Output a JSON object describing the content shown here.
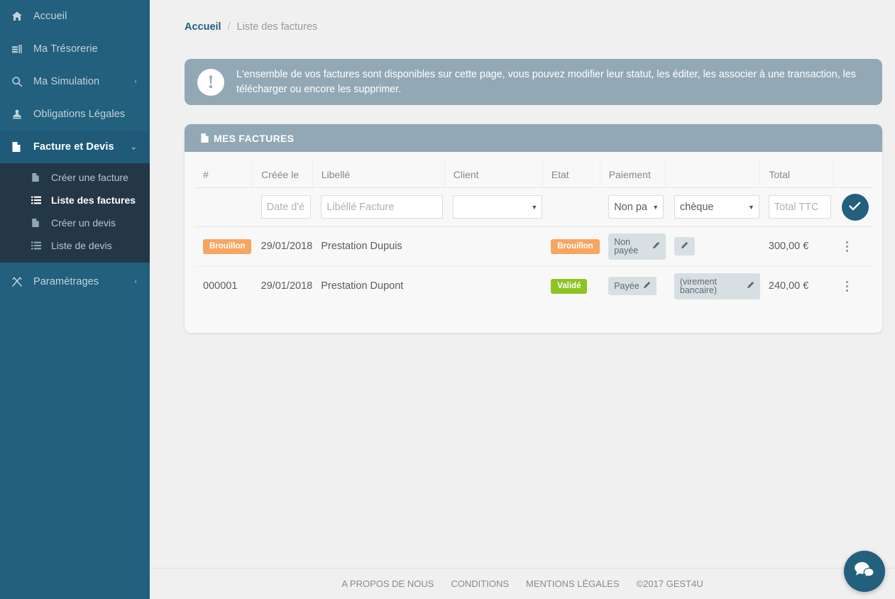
{
  "sidebar": {
    "items": [
      {
        "label": "Accueil",
        "icon": "home-icon",
        "active": false,
        "caret": null
      },
      {
        "label": "Ma Trésorerie",
        "icon": "money-stack-icon",
        "active": false,
        "caret": null
      },
      {
        "label": "Ma Simulation",
        "icon": "search-icon",
        "active": false,
        "caret": "‹"
      },
      {
        "label": "Obligations Légales",
        "icon": "stamp-icon",
        "active": false,
        "caret": null
      },
      {
        "label": "Facture et Devis",
        "icon": "document-icon",
        "active": true,
        "caret": "⌄"
      },
      {
        "label": "Paramètrages",
        "icon": "tools-icon",
        "active": false,
        "caret": "‹"
      }
    ],
    "submenu": [
      {
        "label": "Créer une facture",
        "icon": "document-icon",
        "active": false
      },
      {
        "label": "Liste des factures",
        "icon": "list-icon",
        "active": true
      },
      {
        "label": "Créer un devis",
        "icon": "document-icon",
        "active": false
      },
      {
        "label": "Liste de devis",
        "icon": "list-icon",
        "active": false
      }
    ]
  },
  "breadcrumb": {
    "home": "Accueil",
    "separator": "/",
    "current": "Liste des factures"
  },
  "alert": {
    "icon": "exclamation-icon",
    "text": "L'ensemble de vos factures sont disponibles sur cette page, vous pouvez modifier leur statut, les éditer, les associer à une transaction, les télécharger ou encore les supprimer."
  },
  "card": {
    "title": "MES FACTURES",
    "icon": "document-icon"
  },
  "table": {
    "headers": [
      "#",
      "Créée le",
      "Libellé",
      "Client",
      "Etat",
      "Paiement",
      "",
      "Total",
      ""
    ],
    "filters": {
      "date_placeholder": "Date d'é",
      "libelle_placeholder": "Libéllé Facture",
      "client_value": "",
      "paiement_value": "Non pa",
      "mode_value": "chèque",
      "total_placeholder": "Total TTC",
      "search_icon": "check-icon"
    },
    "rows": [
      {
        "num": "Brouillon",
        "num_is_badge": true,
        "num_badge_color": "#f7a55f",
        "date": "29/01/2018",
        "libelle": "Prestation Dupuis",
        "client": "",
        "etat": "Brouillon",
        "etat_color": "#f7a55f",
        "paiement": "Non payée",
        "mode": "",
        "total": "300,00 €",
        "menu_icon": "kebab-menu-icon"
      },
      {
        "num": "000001",
        "num_is_badge": false,
        "num_badge_color": "",
        "date": "29/01/2018",
        "libelle": "Prestation Dupont",
        "client": "",
        "etat": "Validé",
        "etat_color": "#8dc422",
        "paiement": "Payée",
        "mode": "(virement bancaire)",
        "total": "240,00 €",
        "menu_icon": "kebab-menu-icon"
      }
    ]
  },
  "footer": {
    "links": [
      "A PROPOS DE NOUS",
      "CONDITIONS",
      "MENTIONS LÉGALES"
    ],
    "copyright": "©2017 GEST4U"
  },
  "chat": {
    "icon": "chat-bubbles-icon"
  },
  "colors": {
    "sidebar_bg": "#22607d",
    "sidebar_submenu_bg": "#233746",
    "accent": "#22607d",
    "card_header": "#92a9b5",
    "alert_bg": "#92a9b5",
    "badge_draft": "#f7a55f",
    "badge_valid": "#8dc422",
    "pill_bg": "#d7dfe3"
  }
}
